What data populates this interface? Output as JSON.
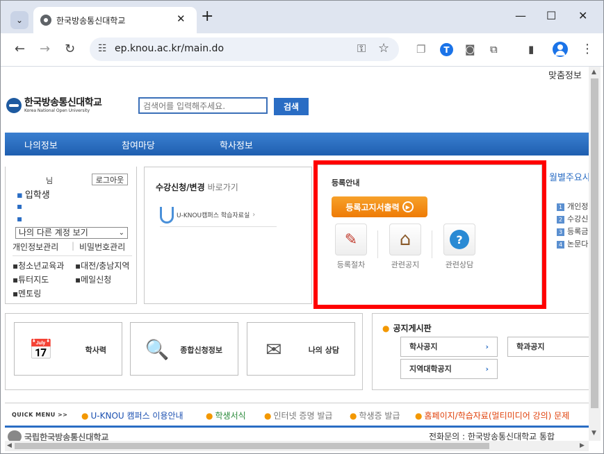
{
  "browser": {
    "tab_title": "한국방송통신대학교",
    "tab_close": "✕",
    "new_tab": "+",
    "url": "ep.knou.ac.kr/main.do",
    "window_controls": {
      "minimize": "—",
      "maximize": "☐",
      "close": "✕"
    }
  },
  "page": {
    "custom_info": "맞춤정보",
    "logo": {
      "korean": "한국방송통신대학교",
      "english": "Korea National Open University",
      "prefix": "국립"
    },
    "search": {
      "placeholder": "검색어를 입력해주세요.",
      "button": "검색"
    },
    "nav": [
      "나의정보",
      "참여마당",
      "학사정보"
    ],
    "login": {
      "suffix": "님",
      "logout": "로그아웃",
      "status": "입학생",
      "account_select": "나의 다른 계정 보기",
      "links": [
        "개인정보관리",
        "비밀번호관리"
      ],
      "separator": "|",
      "sub_links": [
        "청소년교육과",
        "대전/충남지역",
        "튜터지도",
        "메일신청",
        "멘토링"
      ]
    },
    "course": {
      "title": "수강신청/변경",
      "go": "바로가기",
      "uknou_label": "U-KNOU캠퍼스 학습자료실",
      "arrow": "›"
    },
    "registration": {
      "title": "등록안내",
      "print_button": "등록고지서출력",
      "print_icon": "▶",
      "items": [
        {
          "label": "등록절차",
          "icon": "✎",
          "icon_name": "pencil-icon"
        },
        {
          "label": "관련공지",
          "icon": "⌂",
          "icon_name": "house-icon"
        },
        {
          "label": "관련상담",
          "icon": "?",
          "icon_name": "headset-icon"
        }
      ]
    },
    "weekly": {
      "title": "월별주요사",
      "items": [
        {
          "num": "1",
          "text": "개인정"
        },
        {
          "num": "2",
          "text": "수강신"
        },
        {
          "num": "3",
          "text": "등록금"
        },
        {
          "num": "4",
          "text": "논문다"
        }
      ]
    },
    "quick_cards": [
      {
        "label": "학사력",
        "icon": "📅",
        "icon_name": "calendar-clock-icon"
      },
      {
        "label": "종합신청정보",
        "icon": "🔍",
        "icon_name": "magnifier-folder-icon"
      },
      {
        "label": "나의 상담",
        "icon": "✉",
        "icon_name": "quill-envelope-icon"
      }
    ],
    "notice": {
      "title": "공지게시판",
      "buttons": [
        "학사공지",
        "학과공지",
        "지역대학공지"
      ],
      "chev": "›"
    },
    "quick_menu": {
      "label": "QUICK MENU",
      "arrows": ">>",
      "items": [
        {
          "text": "U-KNOU 캠퍼스 이용안내",
          "color": "#1a4fb0"
        },
        {
          "text": "학생서식",
          "color": "#2a8a3a"
        },
        {
          "text": "인터넷 증명 발급",
          "color": "#777777"
        },
        {
          "text": "학생증 발급",
          "color": "#777777"
        },
        {
          "text": "홈페이지/학습자료(멀티미디어 강의) 문제",
          "color": "#e0400a"
        }
      ]
    },
    "footer": {
      "logo_text": "국립한국방송통신대학교",
      "contact": "전화문의 : 한국방송통신대학교 통합"
    }
  },
  "colors": {
    "accent_blue": "#2a6dc4",
    "highlight_red": "#ff0000",
    "orange": "#f39800"
  }
}
